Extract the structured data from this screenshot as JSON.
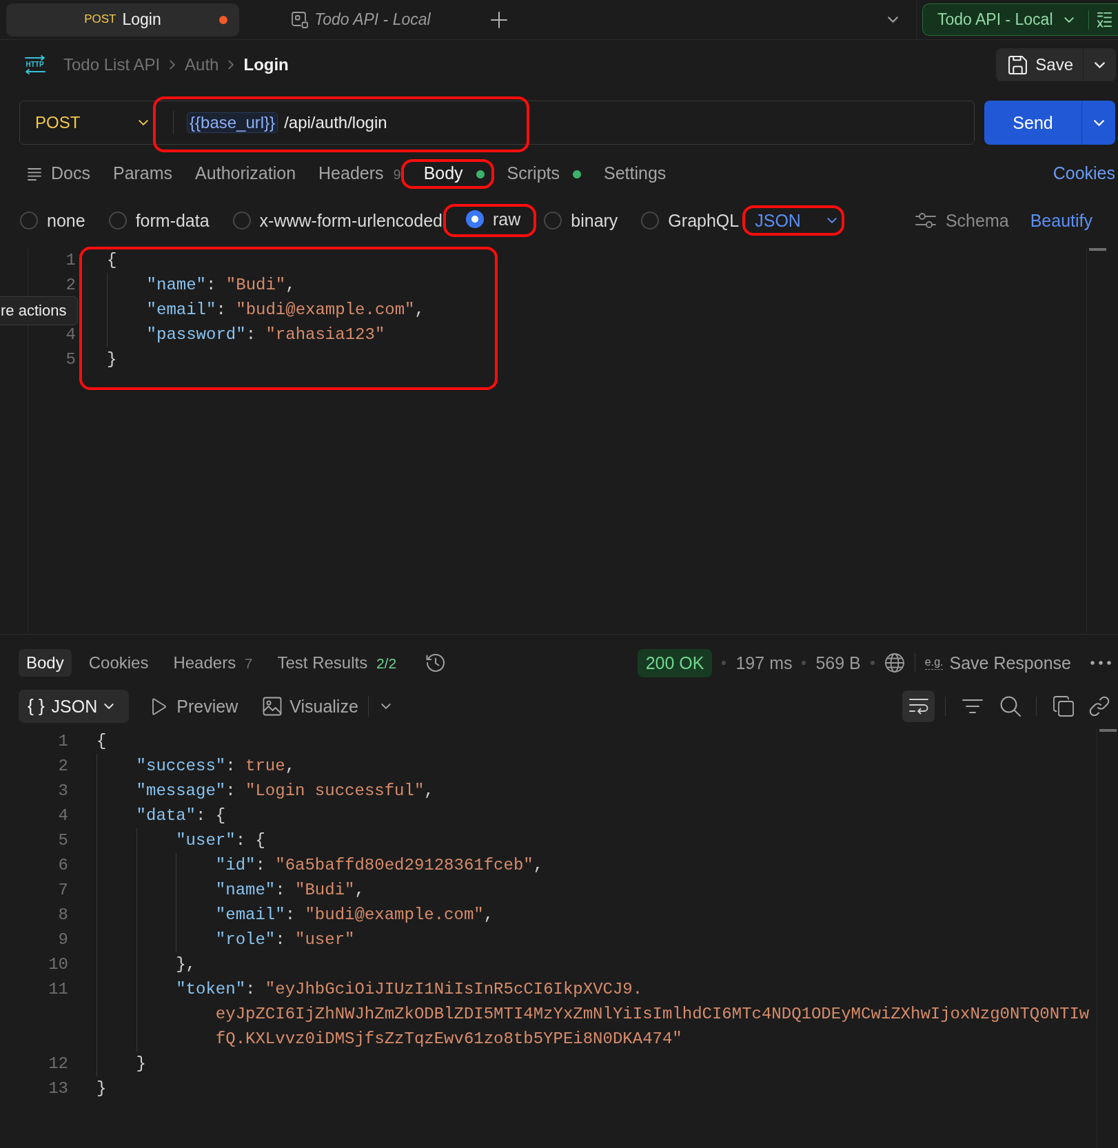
{
  "tabs": [
    {
      "method": "POST",
      "title": "Login",
      "selected": true,
      "unsaved": true,
      "preview": false
    },
    {
      "title": "Todo API - Local",
      "selected": false,
      "unsaved": false,
      "preview": true
    }
  ],
  "environment": "Todo API - Local",
  "breadcrumb": {
    "icon_text": "HTTP",
    "items": [
      "Todo List API",
      "Auth",
      "Login"
    ]
  },
  "save_label": "Save",
  "request": {
    "method": "POST",
    "url": {
      "variable": "{{base_url}}",
      "path": "/api/auth/login",
      "highlighted": true
    },
    "send_label": "Send",
    "tabs": [
      {
        "label": "Docs",
        "selected": false,
        "indicator": false,
        "highlighted": false
      },
      {
        "label": "Params",
        "selected": false,
        "indicator": false,
        "highlighted": false
      },
      {
        "label": "Authorization",
        "selected": false,
        "indicator": false,
        "highlighted": false
      },
      {
        "label": "Headers",
        "count": "9",
        "selected": false,
        "indicator": false,
        "highlighted": false
      },
      {
        "label": "Body",
        "selected": true,
        "indicator": true,
        "highlighted": true
      },
      {
        "label": "Scripts",
        "selected": false,
        "indicator": true,
        "highlighted": false
      },
      {
        "label": "Settings",
        "selected": false,
        "indicator": false,
        "highlighted": false
      }
    ],
    "cookies_label": "Cookies",
    "body_types": [
      {
        "label": "none",
        "selected": false,
        "highlighted": false
      },
      {
        "label": "form-data",
        "selected": false,
        "highlighted": false
      },
      {
        "label": "x-www-form-urlencoded",
        "selected": false,
        "highlighted": false
      },
      {
        "label": "raw",
        "selected": true,
        "highlighted": true
      },
      {
        "label": "binary",
        "selected": false,
        "highlighted": false
      },
      {
        "label": "GraphQL",
        "selected": false,
        "highlighted": false
      }
    ],
    "body_language": {
      "label": "JSON",
      "highlighted": true
    },
    "schema_label": "Schema",
    "beautify_label": "Beautify",
    "body": {
      "highlighted": true,
      "lines": [
        {
          "number": "1",
          "code": "{"
        },
        {
          "number": "2",
          "code": "    \"name\": \"Budi\","
        },
        {
          "code": "    \"email\": \"budi@example.com\","
        },
        {
          "number": "4",
          "code": "    \"password\": \"rahasia123\""
        },
        {
          "number": "5",
          "code": "}"
        }
      ]
    },
    "tooltip": "re actions"
  },
  "response": {
    "tabs": [
      {
        "label": "Body",
        "selected": true
      },
      {
        "label": "Cookies",
        "selected": false
      },
      {
        "label": "Headers",
        "count": "7",
        "color": "#6e6e6e",
        "selected": false
      },
      {
        "label": "Test Results",
        "count": "2/2",
        "color": "#6fd391",
        "selected": false
      }
    ],
    "status": "200 OK",
    "time": "197 ms",
    "size": "569 B",
    "save_response": {
      "icon_text": "e.g.",
      "label": "Save Response"
    },
    "format": {
      "glyph": "{ }",
      "label": "JSON"
    },
    "preview_label": "Preview",
    "visualize_label": "Visualize",
    "wrap_lines": true,
    "lines": [
      {
        "kind": "line",
        "number": "1",
        "code": "{"
      },
      {
        "kind": "line",
        "number": "2",
        "code": "    \"success\": true,"
      },
      {
        "kind": "line",
        "number": "3",
        "code": "    \"message\": \"Login successful\","
      },
      {
        "kind": "line",
        "number": "4",
        "code": "    \"data\": {"
      },
      {
        "kind": "line",
        "number": "5",
        "code": "        \"user\": {"
      },
      {
        "kind": "line",
        "number": "6",
        "code": "            \"id\": \"6a5baffd80ed29128361fceb\","
      },
      {
        "kind": "line",
        "number": "7",
        "code": "            \"name\": \"Budi\","
      },
      {
        "kind": "line",
        "number": "8",
        "code": "            \"email\": \"budi@example.com\","
      },
      {
        "kind": "line",
        "number": "9",
        "code": "            \"role\": \"user\""
      },
      {
        "kind": "line",
        "number": "10",
        "code": "        },"
      },
      {
        "kind": "line",
        "number": "11",
        "code": "        \"token\": \"eyJhbGciOiJIUzI1NiIsInR5cCI6IkpXVCJ9."
      },
      {
        "kind": "wrap",
        "code": "eyJpZCI6IjZhNWJhZmZkODBlZDI5MTI4MzYxZmNlYiIsImlhdCI6MTc4NDQ1ODEyMCwiZXhwIjoxNzg0NTQ0NTIw"
      },
      {
        "kind": "wrap",
        "code": "fQ.KXLvvz0iDMSjfsZzTqzEwv61zo8tb5YPEi8N0DKA474\""
      },
      {
        "kind": "line",
        "number": "12",
        "code": "    }"
      },
      {
        "kind": "line",
        "number": "13",
        "code": "}"
      }
    ]
  }
}
